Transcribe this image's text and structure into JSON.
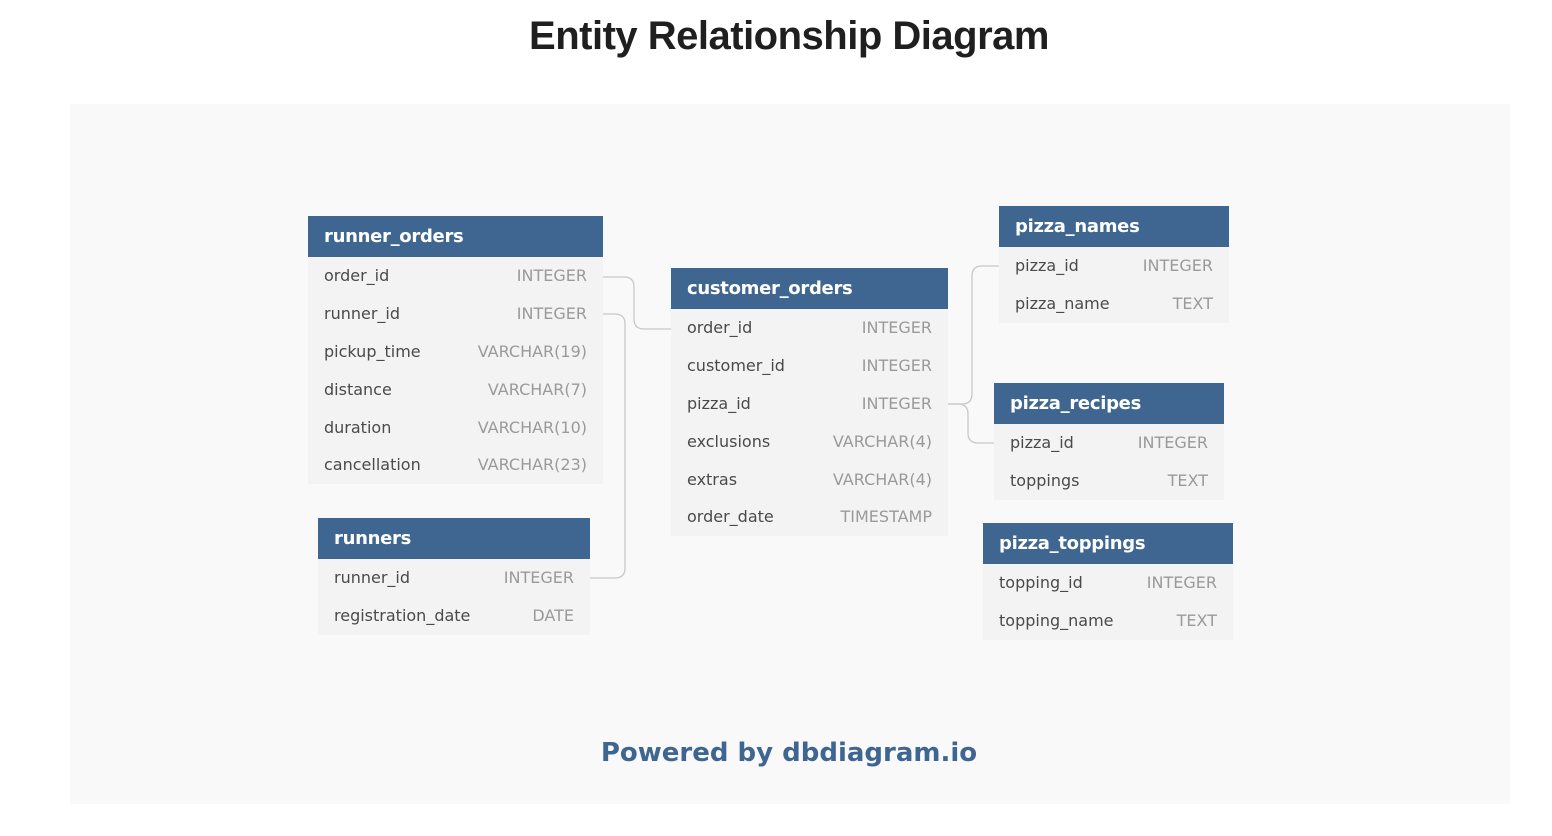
{
  "title": "Entity Relationship Diagram",
  "footer": "Powered by dbdiagram.io",
  "colors": {
    "header_bg": "#3e6690",
    "canvas_bg": "#f9f9f9",
    "row_bg": "#f3f3f3",
    "connector": "#c8c8c8",
    "footer_text": "#3e6690"
  },
  "tables": {
    "runner_orders": {
      "name": "runner_orders",
      "columns": [
        {
          "name": "order_id",
          "type": "INTEGER"
        },
        {
          "name": "runner_id",
          "type": "INTEGER"
        },
        {
          "name": "pickup_time",
          "type": "VARCHAR(19)"
        },
        {
          "name": "distance",
          "type": "VARCHAR(7)"
        },
        {
          "name": "duration",
          "type": "VARCHAR(10)"
        },
        {
          "name": "cancellation",
          "type": "VARCHAR(23)"
        }
      ]
    },
    "runners": {
      "name": "runners",
      "columns": [
        {
          "name": "runner_id",
          "type": "INTEGER"
        },
        {
          "name": "registration_date",
          "type": "DATE"
        }
      ]
    },
    "customer_orders": {
      "name": "customer_orders",
      "columns": [
        {
          "name": "order_id",
          "type": "INTEGER"
        },
        {
          "name": "customer_id",
          "type": "INTEGER"
        },
        {
          "name": "pizza_id",
          "type": "INTEGER"
        },
        {
          "name": "exclusions",
          "type": "VARCHAR(4)"
        },
        {
          "name": "extras",
          "type": "VARCHAR(4)"
        },
        {
          "name": "order_date",
          "type": "TIMESTAMP"
        }
      ]
    },
    "pizza_names": {
      "name": "pizza_names",
      "columns": [
        {
          "name": "pizza_id",
          "type": "INTEGER"
        },
        {
          "name": "pizza_name",
          "type": "TEXT"
        }
      ]
    },
    "pizza_recipes": {
      "name": "pizza_recipes",
      "columns": [
        {
          "name": "pizza_id",
          "type": "INTEGER"
        },
        {
          "name": "toppings",
          "type": "TEXT"
        }
      ]
    },
    "pizza_toppings": {
      "name": "pizza_toppings",
      "columns": [
        {
          "name": "topping_id",
          "type": "INTEGER"
        },
        {
          "name": "topping_name",
          "type": "TEXT"
        }
      ]
    }
  },
  "relationships": [
    {
      "from": "runner_orders.order_id",
      "to": "customer_orders.order_id"
    },
    {
      "from": "runner_orders.runner_id",
      "to": "runners.runner_id"
    },
    {
      "from": "customer_orders.pizza_id",
      "to": "pizza_names.pizza_id"
    },
    {
      "from": "customer_orders.pizza_id",
      "to": "pizza_recipes.pizza_id"
    }
  ]
}
